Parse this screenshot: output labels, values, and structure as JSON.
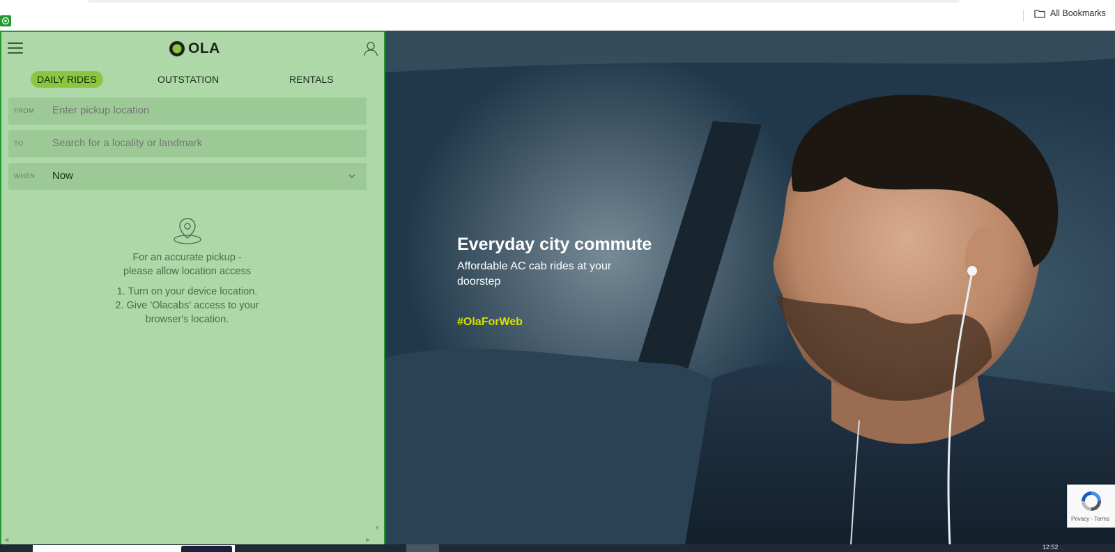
{
  "browser": {
    "bookmarks_label": "All Bookmarks"
  },
  "app": {
    "logo_text": "OLA",
    "tabs": [
      {
        "label": "DAILY RIDES",
        "active": true
      },
      {
        "label": "OUTSTATION",
        "active": false
      },
      {
        "label": "RENTALS",
        "active": false
      }
    ],
    "form": {
      "from": {
        "label": "FROM",
        "placeholder": "Enter pickup location"
      },
      "to": {
        "label": "TO",
        "placeholder": "Search for a locality or landmark"
      },
      "when": {
        "label": "WHEN",
        "value": "Now"
      }
    },
    "location_notice": {
      "line1": "For an accurate pickup -",
      "line2": "please allow location access",
      "step1": "1. Turn on your device location.",
      "step2": "2. Give 'Olacabs' access to your",
      "step2b": "browser's location."
    }
  },
  "hero": {
    "title": "Everyday city commute",
    "subtitle": "Affordable AC cab rides at your doorstep",
    "tag": "#OlaForWeb"
  },
  "recaptcha": {
    "links": "Privacy - Terms"
  },
  "taskbar": {
    "clock": "12:52"
  },
  "colors": {
    "panel_bg": "#aed8a8",
    "panel_border": "#1f9a2d",
    "accent": "#8cc63e",
    "tag": "#d6e200"
  }
}
